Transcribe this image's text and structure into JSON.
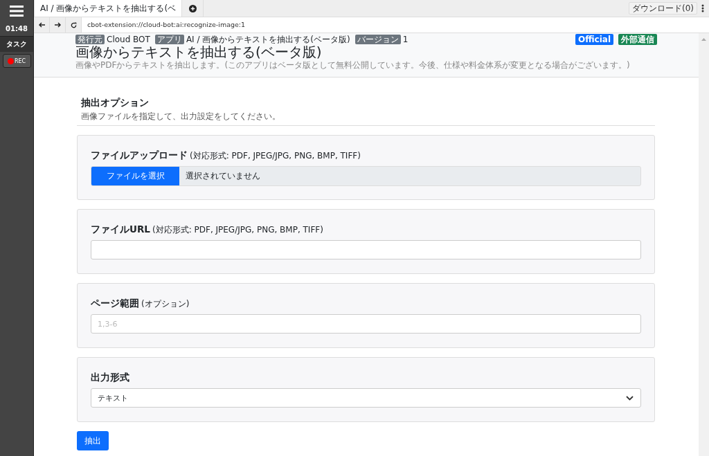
{
  "sidebar": {
    "time": "01:48",
    "task_label": "タスク",
    "rec_button": "REC"
  },
  "browser": {
    "tabs": [
      {
        "label": "AI / 画像からテキストを抽出する(ベ",
        "selected": true
      }
    ],
    "download_button": "ダウンロード(0)",
    "address": "cbot-extension://cloud-bot:ai:recognize-image:1"
  },
  "app_header": {
    "meta": [
      {
        "badge": "発行元",
        "value": "Cloud BOT"
      },
      {
        "badge": "アプリ",
        "value": "AI / 画像からテキストを抽出する(ベータ版)"
      },
      {
        "badge": "バージョン",
        "value": "1"
      }
    ],
    "tags": [
      {
        "label": "Official",
        "color": "#0d6efd"
      },
      {
        "label": "外部通信",
        "color": "#198754"
      }
    ],
    "title": "画像からテキストを抽出する(ベータ版)",
    "description": "画像やPDFからテキストを抽出します。(このアプリはベータ版として無料公開しています。今後、仕様や料金体系が変更となる場合がございます。)"
  },
  "form": {
    "heading": "抽出オプション",
    "subheading": "画像ファイルを指定して、出力設定をしてください。",
    "sections": [
      {
        "kind": "file",
        "label": "ファイルアップロード",
        "note": "(対応形式: PDF, JPEG/JPG, PNG, BMP, TIFF)",
        "button": "ファイルを選択",
        "value": "選択されていません"
      },
      {
        "kind": "text",
        "label": "ファイルURL",
        "note": "(対応形式: PDF, JPEG/JPG, PNG, BMP, TIFF)"
      },
      {
        "kind": "text",
        "label": "ページ範囲",
        "note": "(オプション)",
        "placeholder": "1,3-6"
      },
      {
        "kind": "select",
        "label": "出力形式",
        "value": "テキスト"
      }
    ],
    "submit": "抽出"
  }
}
